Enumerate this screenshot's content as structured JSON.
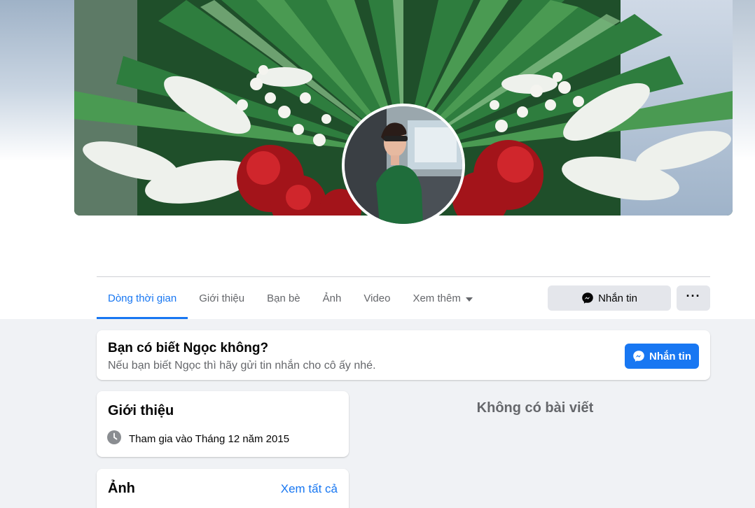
{
  "profile": {
    "cover_alt": "cover-photo",
    "avatar_alt": "profile-picture"
  },
  "tabs": [
    {
      "label": "Dòng thời gian",
      "active": true
    },
    {
      "label": "Giới thiệu"
    },
    {
      "label": "Bạn bè"
    },
    {
      "label": "Ảnh"
    },
    {
      "label": "Video"
    },
    {
      "label": "Xem thêm"
    }
  ],
  "actions": {
    "message_label": "Nhắn tin",
    "more_label": "···"
  },
  "know_card": {
    "title": "Bạn có biết Ngọc không?",
    "subtitle": "Nếu bạn biết Ngọc thì hãy gửi tin nhắn cho cô ấy nhé.",
    "button_label": "Nhắn tin"
  },
  "intro": {
    "title": "Giới thiệu",
    "joined": "Tham gia vào Tháng 12 năm 2015"
  },
  "photos": {
    "title": "Ảnh",
    "see_all": "Xem tất cả"
  },
  "posts": {
    "empty_text": "Không có bài viết"
  },
  "colors": {
    "accent": "#1877f2",
    "background": "#f0f2f5",
    "secondary_text": "#65676b"
  }
}
